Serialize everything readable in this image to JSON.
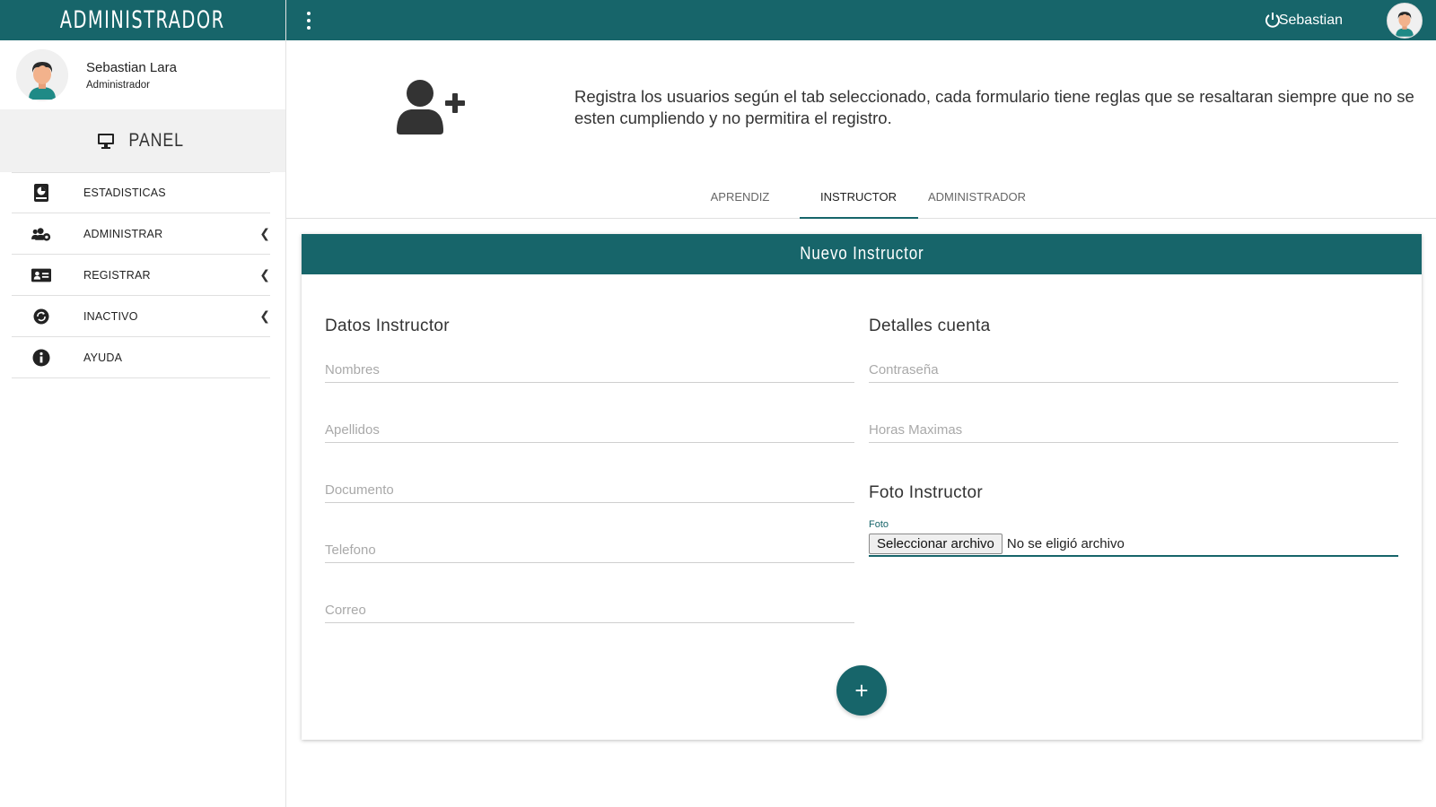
{
  "sidebar": {
    "title": "ADMINISTRADOR",
    "profile": {
      "name": "Sebastian Lara",
      "role": "Administrador"
    },
    "panel_label": "PANEL",
    "items": [
      {
        "label": "ESTADISTICAS",
        "icon": "stats-icon",
        "has_submenu": false
      },
      {
        "label": "ADMINISTRAR",
        "icon": "users-cog-icon",
        "has_submenu": true
      },
      {
        "label": "REGISTRAR",
        "icon": "id-card-icon",
        "has_submenu": true
      },
      {
        "label": "INACTIVO",
        "icon": "inactive-icon",
        "has_submenu": true
      },
      {
        "label": "AYUDA",
        "icon": "info-icon",
        "has_submenu": false
      }
    ]
  },
  "topbar": {
    "user_name": "Sebastian"
  },
  "intro": {
    "text": "Registra los usuarios según el tab seleccionado, cada formulario tiene reglas que se resaltaran siempre que no se esten cumpliendo y no permitira el registro."
  },
  "tabs": [
    {
      "label": "APRENDIZ",
      "active": false
    },
    {
      "label": "INSTRUCTOR",
      "active": true
    },
    {
      "label": "ADMINISTRADOR",
      "active": false
    }
  ],
  "form": {
    "title": "Nuevo Instructor",
    "left_section_title": "Datos Instructor",
    "right_section_title": "Detalles cuenta",
    "photo_section_title": "Foto Instructor",
    "placeholders": {
      "nombres": "Nombres",
      "apellidos": "Apellidos",
      "documento": "Documento",
      "telefono": "Telefono",
      "correo": "Correo",
      "contrasena": "Contraseña",
      "horas": "Horas Maximas"
    },
    "foto_label": "Foto",
    "file_button": "Seleccionar archivo",
    "file_status": "No se eligió archivo",
    "submit_symbol": "+"
  },
  "colors": {
    "primary": "#17656a",
    "panel_bg": "#f1f1f1"
  }
}
